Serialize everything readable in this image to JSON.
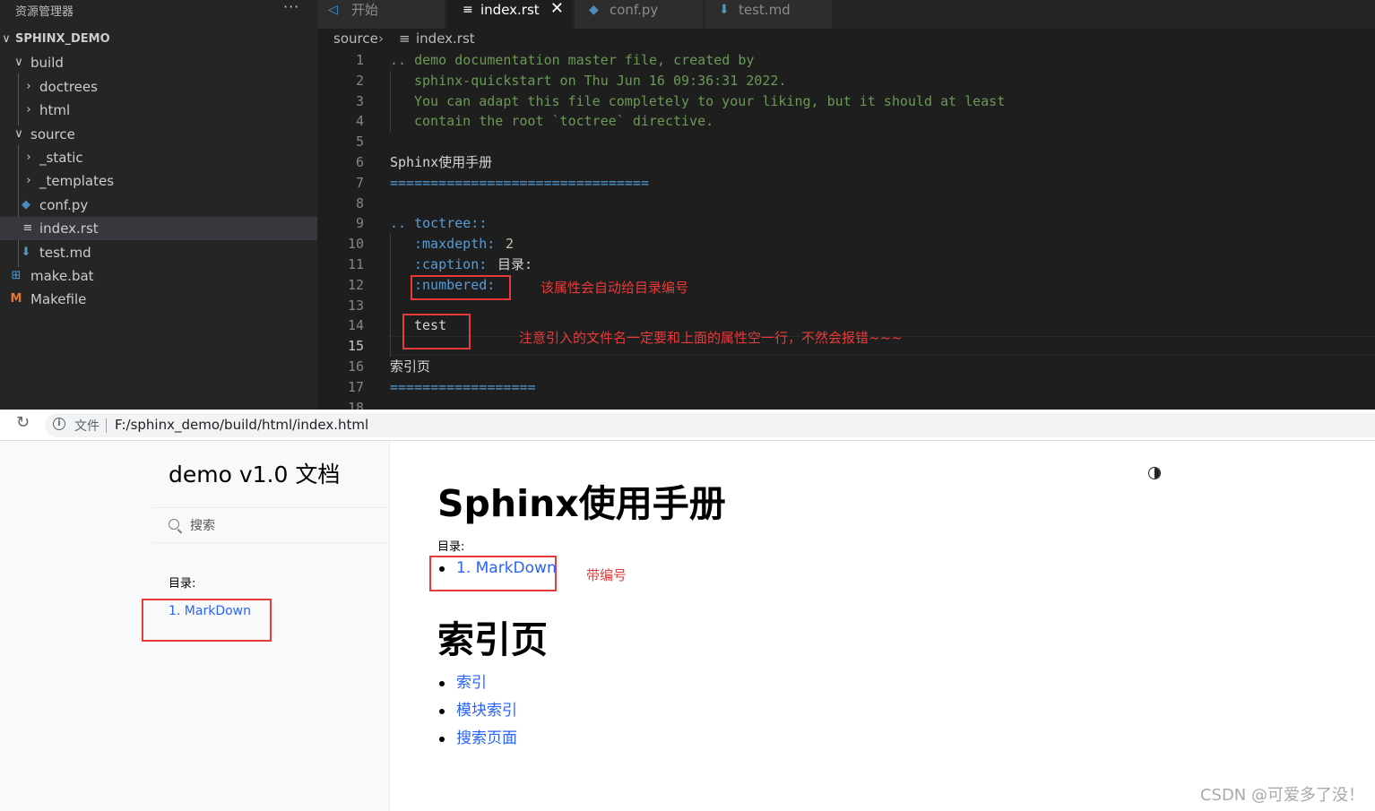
{
  "explorer": {
    "title": "资源管理器",
    "more": "···",
    "tree": [
      {
        "label": "SPHINX_DEMO",
        "chevron": "∨",
        "icon": ""
      },
      {
        "label": "build",
        "chevron": "∨",
        "icon": ""
      },
      {
        "label": "doctrees",
        "chevron": "›",
        "icon": ""
      },
      {
        "label": "html",
        "chevron": "›",
        "icon": ""
      },
      {
        "label": "source",
        "chevron": "∨",
        "icon": ""
      },
      {
        "label": "_static",
        "chevron": "›",
        "icon": ""
      },
      {
        "label": "_templates",
        "chevron": "›",
        "icon": ""
      },
      {
        "label": "conf.py",
        "chevron": "",
        "icon": "◆"
      },
      {
        "label": "index.rst",
        "chevron": "",
        "icon": "≡"
      },
      {
        "label": "test.md",
        "chevron": "",
        "icon": "⬇"
      },
      {
        "label": "make.bat",
        "chevron": "",
        "icon": "⊞"
      },
      {
        "label": "Makefile",
        "chevron": "",
        "icon": "M"
      }
    ]
  },
  "tabs": [
    {
      "label": "开始",
      "icon": "◁",
      "color": "#3b9ae1"
    },
    {
      "label": "index.rst",
      "icon": "≡",
      "color": "#ffffff",
      "close": "✕"
    },
    {
      "label": "conf.py",
      "icon": "◆",
      "color": "#4b8bbe"
    },
    {
      "label": "test.md",
      "icon": "⬇",
      "color": "#519aba"
    }
  ],
  "breadcrumb": {
    "folder": "source",
    "sep": "›",
    "icon": "≡",
    "file": "index.rst"
  },
  "editor": {
    "line_numbers": [
      "1",
      "2",
      "3",
      "4",
      "5",
      "6",
      "7",
      "8",
      "9",
      "10",
      "11",
      "12",
      "13",
      "14",
      "15",
      "16",
      "17",
      "18"
    ],
    "current_line": "15",
    "lines": {
      "l1": ".. demo documentation master file, created by",
      "l2": "sphinx-quickstart on Thu Jun 16 09:36:31 2022.",
      "l3": "You can adapt this file completely to your liking, but it should at least",
      "l4": "contain the root `toctree` directive.",
      "l6": "Sphinx使用手册",
      "l7": "================================",
      "l9": ".. toctree::",
      "l10_key": ":maxdepth:",
      "l10_val": "2",
      "l11_key": ":caption:",
      "l11_val": "目录:",
      "l12": ":numbered:",
      "l14": "test",
      "l16": "索引页",
      "l17": "=================="
    },
    "notes": {
      "numbered": "该属性会自动给目录编号",
      "blank_line": "注意引入的文件名一定要和上面的属性空一行，不然会报错~~~"
    }
  },
  "browser": {
    "reload": "↻",
    "forward": "›",
    "info": "i",
    "file_label": "文件",
    "url": "F:/sphinx_demo/build/html/index.html",
    "sidebar": {
      "brand": "demo v1.0 文档",
      "search_placeholder": "搜索",
      "caption": "目录:",
      "link": "1. MarkDown"
    },
    "content": {
      "title": "Sphinx使用手册",
      "caption": "目录:",
      "toc_link": "1. MarkDown",
      "toc_note": "带编号",
      "index_title": "索引页",
      "index_links": [
        "索引",
        "模块索引",
        "搜索页面"
      ]
    }
  },
  "watermark": "CSDN @可爱多了没！",
  "colors": {
    "annotation_red": "#e83a3a",
    "link_blue": "#2962ff",
    "comment_green": "#6a9955",
    "keyword_blue": "#569cd6"
  }
}
